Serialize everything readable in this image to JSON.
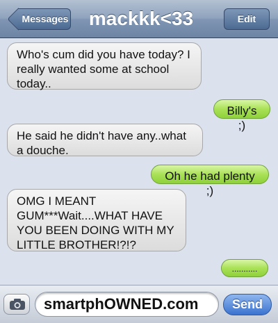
{
  "nav": {
    "back_label": "Messages",
    "title": "mackkk<33",
    "edit_label": "Edit"
  },
  "messages": [
    {
      "side": "received",
      "text": "Who's cum did you have today? I really wanted some at school today.."
    },
    {
      "side": "sent",
      "text": "Billy's ;)"
    },
    {
      "side": "received",
      "text": "He said he didn't have any..what a douche."
    },
    {
      "side": "sent",
      "text": "Oh he had plenty ;)"
    },
    {
      "side": "received",
      "text": "OMG I MEANT GUM***Wait....WHAT HAVE YOU BEEN DOING WITH MY LITTLE BROTHER!?!?"
    },
    {
      "side": "sent",
      "text": "..........."
    }
  ],
  "input": {
    "camera_icon": "camera-icon",
    "text_value": "smartphOWNED.com",
    "send_label": "Send"
  },
  "colors": {
    "nav_bar": "#7f95b3",
    "sent_bubble": "#a9e157",
    "received_bubble": "#e6e6e6",
    "send_button": "#3a73cf",
    "background": "#dbe2ed"
  }
}
